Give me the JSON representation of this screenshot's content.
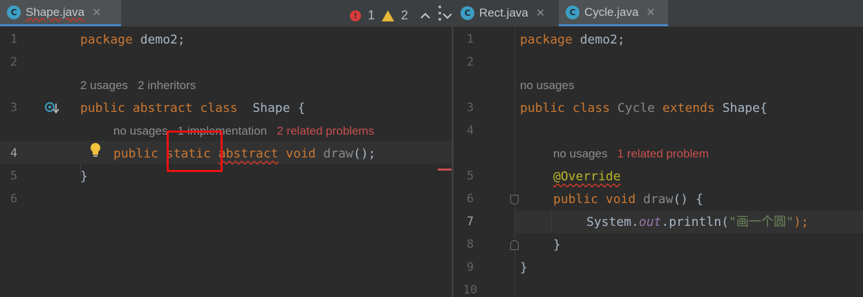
{
  "left": {
    "tabs": [
      {
        "name": "Shape.java",
        "icon": "class-file-icon",
        "icon_letter": "C",
        "active": true,
        "has_error": true
      }
    ],
    "inspection": {
      "errors": "1",
      "warnings": "2"
    },
    "line_numbers": [
      "1",
      "2",
      "3",
      "4",
      "5",
      "6"
    ],
    "code": {
      "line1_kw": "package",
      "line1_rest": " demo2;",
      "line3_public": "public",
      "line3_abstract": "abstract",
      "line3_class": "class",
      "line3_name": "Shape",
      "line3_brace": " {",
      "line4_public": "public",
      "line4_static": "static",
      "line4_abstract": "abstract",
      "line4_void": "void",
      "line4_method": "draw",
      "line4_end": "();",
      "line5": "}"
    },
    "hints": {
      "class_usages": "2 usages",
      "class_inheritors": "2 inheritors",
      "method_usages": "no usages",
      "method_impl": "1 implementation",
      "method_problems": "2 related problems"
    }
  },
  "right": {
    "tabs": [
      {
        "name": "Rect.java",
        "icon_letter": "C",
        "active": false
      },
      {
        "name": "Cycle.java",
        "icon_letter": "C",
        "active": true
      }
    ],
    "line_numbers": [
      "1",
      "2",
      "3",
      "4",
      "5",
      "6",
      "7",
      "8",
      "9",
      "10"
    ],
    "code": {
      "line1_kw": "package",
      "line1_rest": " demo2;",
      "line3_public": "public",
      "line3_class": "class",
      "line3_name": "Cycle",
      "line3_extends": "extends",
      "line3_super": "Shape{",
      "line5": "@Override",
      "line6_public": "public",
      "line6_void": "void",
      "line6_method": "draw",
      "line6_rest": "() {",
      "line7_obj": "System.",
      "line7_field": "out",
      "line7_call": ".println(",
      "line7_str": "\"画一个圆\"",
      "line7_end": ");",
      "line8": "}",
      "line9": "}"
    },
    "hints": {
      "class_usages": "no usages",
      "method_usages": "no usages",
      "method_problems": "1 related problem"
    }
  },
  "colors": {
    "keyword": "#cc7832",
    "error": "#d83b3b",
    "warning": "#e8b839",
    "highlight_box": "#ee1111"
  }
}
